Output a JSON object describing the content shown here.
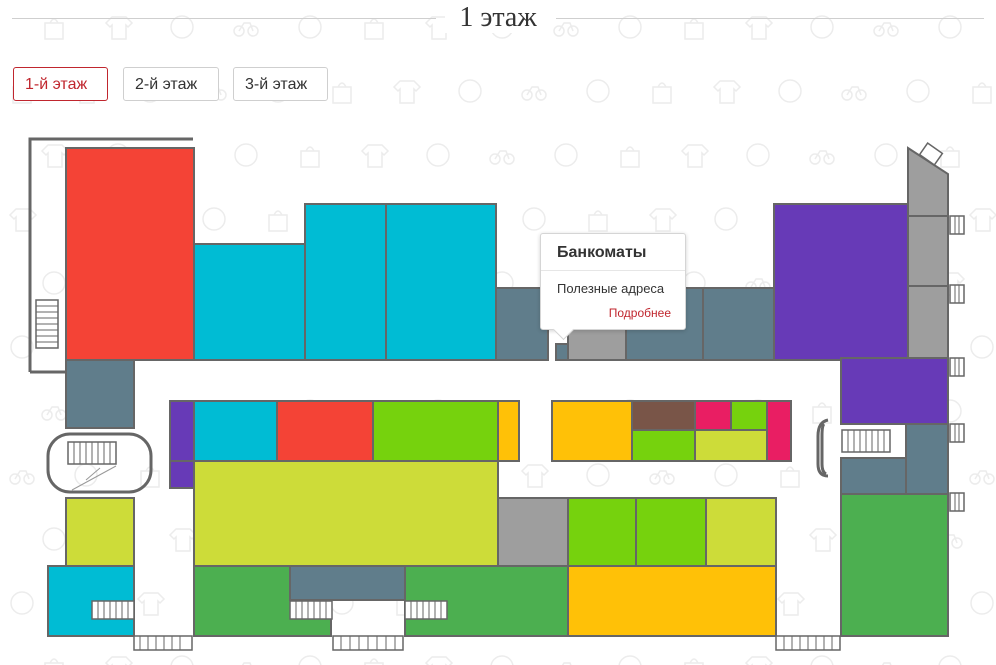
{
  "page": {
    "title": "1 этаж"
  },
  "floors": [
    {
      "label": "1-й этаж",
      "active": true
    },
    {
      "label": "2-й этаж",
      "active": false
    },
    {
      "label": "3-й этаж",
      "active": false
    }
  ],
  "colors": {
    "red": "#f44336",
    "cyan": "#00bcd4",
    "slate": "#607d8b",
    "gray": "#9e9e9e",
    "purple": "#673ab7",
    "lime": "#cddc39",
    "green_light": "#76d20d",
    "green": "#4caf50",
    "amber": "#ffc107",
    "brown": "#795548",
    "pink": "#e91e63",
    "wall": "#666666",
    "accent": "#c0262e"
  },
  "tooltip": {
    "title": "Банкоматы",
    "category": "Полезные адреса",
    "link": "Подробнее"
  }
}
